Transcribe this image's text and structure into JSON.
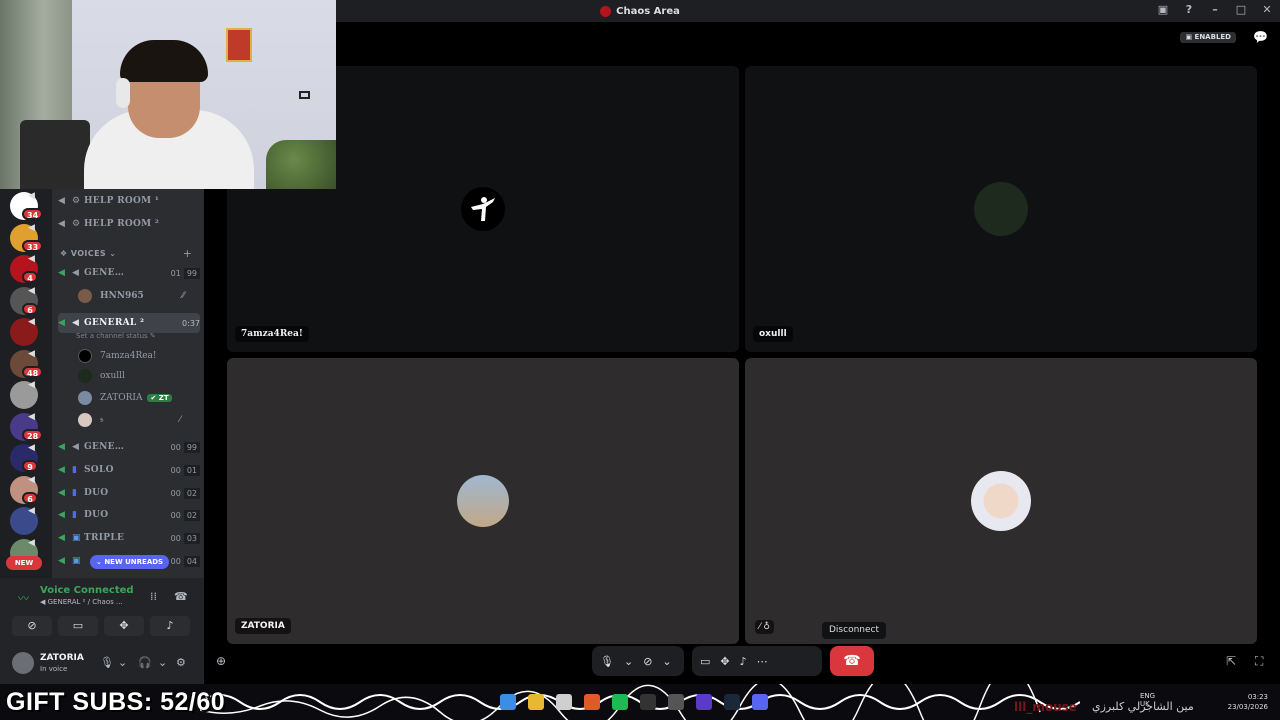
{
  "window": {
    "title": "Chaos Area"
  },
  "header": {
    "enabled_badge": "ENABLED"
  },
  "channels": {
    "help_rooms": [
      {
        "name": "HELP ROOM ¹"
      },
      {
        "name": "HELP ROOM ²"
      }
    ],
    "voices_category": "VOICES",
    "voice_channels": [
      {
        "name": "GENE…",
        "count": "01",
        "limit": "99"
      },
      {
        "name": "GENERAL ²",
        "timer": "0:37",
        "status": "Set a channel status"
      },
      {
        "name": "GENE…",
        "count": "00",
        "limit": "99"
      },
      {
        "name": "SOLO",
        "count": "00",
        "limit": "01"
      },
      {
        "name": "DUO",
        "count": "00",
        "limit": "02"
      },
      {
        "name": "DUO",
        "count": "00",
        "limit": "02"
      },
      {
        "name": "TRIPLE",
        "count": "00",
        "limit": "03"
      },
      {
        "name": "",
        "count": "00",
        "limit": "04"
      }
    ],
    "members_general1": [
      {
        "name": "HNN965"
      }
    ],
    "members_general2": [
      {
        "name": "7amza4Rea!"
      },
      {
        "name": "oxulll"
      },
      {
        "name": "ZATORIA",
        "tag": "ZT"
      },
      {
        "name": "𝔰"
      }
    ],
    "new_unreads": "NEW UNREADS"
  },
  "servers": [
    {
      "badge": "34",
      "color": "#ffffff"
    },
    {
      "badge": "33",
      "color": "#e0a030"
    },
    {
      "badge": "4",
      "color": "#b4141e"
    },
    {
      "badge": "6",
      "color": "#555555"
    },
    {
      "badge": "",
      "color": "#8b1a1a"
    },
    {
      "badge": "48",
      "color": "#6b4a3a"
    },
    {
      "badge": "",
      "color": "#9a9a9a"
    },
    {
      "badge": "28",
      "color": "#4a3a8a"
    },
    {
      "badge": "9",
      "color": "#2a2a6a"
    },
    {
      "badge": "6",
      "color": "#c09080"
    },
    {
      "badge": "",
      "color": "#3a4a8a"
    },
    {
      "badge": "",
      "color": "#6a8a6a"
    }
  ],
  "new_pill": "NEW",
  "voice_panel": {
    "title": "Voice Connected",
    "subtitle": "GENERAL ² / Chaos ..."
  },
  "user_panel": {
    "name": "ZATORIA",
    "status": "In voice"
  },
  "tiles": [
    {
      "name": "7amza4Rea!",
      "avatar_color": "#000000"
    },
    {
      "name": "oxulll",
      "avatar_color": "#1d2a1d"
    },
    {
      "name": "ZATORIA",
      "avatar_color": "#7a8aa0"
    },
    {
      "name": "",
      "avatar_color": "#e8e8f0"
    }
  ],
  "tooltip": "Disconnect",
  "overlay": {
    "gift_subs": "GIFT SUBS: 52/60",
    "name_tag": "lll_mouse",
    "arabic_text": "مين الشاجرلي كلبرزي"
  },
  "clock": {
    "time": "03:23",
    "date": "23/03/2026",
    "lang": "ENG",
    "region": "UK"
  }
}
